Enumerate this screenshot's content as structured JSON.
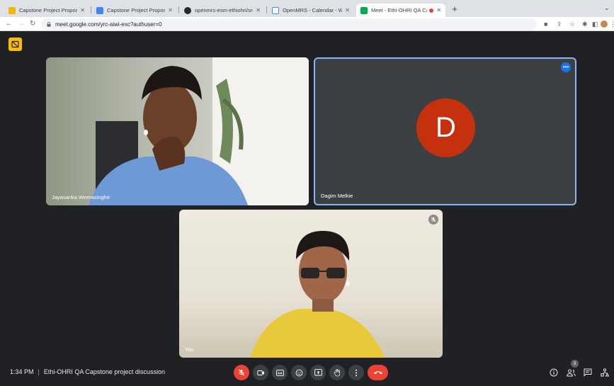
{
  "browser": {
    "tabs": [
      {
        "label": "Capstone Project Proposal - G",
        "favicon": "slides-icon",
        "favicon_color": "#f4b400"
      },
      {
        "label": "Capstone Project Proposal - G",
        "favicon": "docs-icon",
        "favicon_color": "#4285f4"
      },
      {
        "label": "openmrs-esm-ethiohri/src at",
        "favicon": "github-icon",
        "favicon_color": "#24292f"
      },
      {
        "label": "OpenMRS - Calendar - Week o",
        "favicon": "calendar-icon",
        "favicon_color": "#4285f4"
      },
      {
        "label": "Meet - Ethi-OHRI QA Capst",
        "favicon": "meet-icon",
        "favicon_color": "#00ac47"
      }
    ],
    "url": "meet.google.com/yrc-aiwi-exc?authuser=0"
  },
  "participants": [
    {
      "name": "Jayasanka Weerasinghe"
    },
    {
      "name": "Dagim Melkie",
      "initial": "D",
      "avatar_color": "#c5310e"
    },
    {
      "name": "You"
    }
  ],
  "meeting": {
    "time": "1:34 PM",
    "separator": "|",
    "title": "Ethi-OHRI QA Capstone project discussion",
    "participant_count": "3"
  },
  "colors": {
    "accent": "#8ab4f8",
    "danger": "#ea4335",
    "control_bg": "#3c4043"
  }
}
